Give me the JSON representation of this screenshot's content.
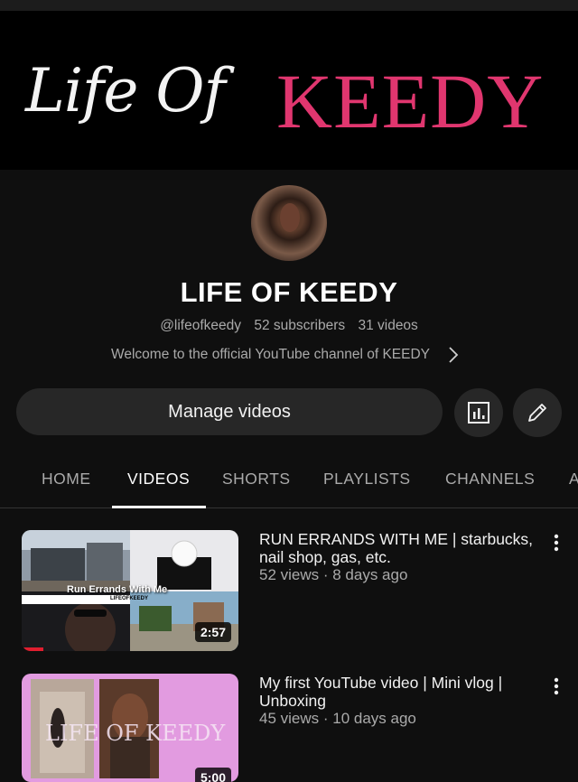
{
  "banner": {
    "script_text": "Life Of",
    "bold_text": "KEEDY"
  },
  "channel": {
    "name": "LIFE OF KEEDY",
    "handle": "@lifeofkeedy",
    "subscribers": "52 subscribers",
    "videos": "31 videos",
    "description": "Welcome to the official YouTube channel of KEEDY"
  },
  "actions": {
    "manage_label": "Manage videos",
    "analytics_icon": "analytics-icon",
    "edit_icon": "pencil-icon"
  },
  "tabs": [
    {
      "label": "HOME",
      "active": false
    },
    {
      "label": "VIDEOS",
      "active": true
    },
    {
      "label": "SHORTS",
      "active": false
    },
    {
      "label": "PLAYLISTS",
      "active": false
    },
    {
      "label": "CHANNELS",
      "active": false
    },
    {
      "label": "A",
      "active": false
    }
  ],
  "videos": [
    {
      "title": "RUN ERRANDS WITH ME | starbucks, nail shop, gas, etc.",
      "meta": "52 views · 8 days ago",
      "duration": "2:57",
      "thumb_caption": "Run Errands With Me",
      "thumb_search": "LIFEOFKEEDY"
    },
    {
      "title": "My first YouTube video | Mini vlog | Unboxing",
      "meta": "45 views · 10 days ago",
      "duration": "5:00",
      "thumb_caption": "LIFE OF KEEDY"
    }
  ],
  "colors": {
    "background": "#0f0f0f",
    "brand_pink": "#e0366f",
    "chip": "#272727",
    "muted_text": "#aaaaaa"
  }
}
